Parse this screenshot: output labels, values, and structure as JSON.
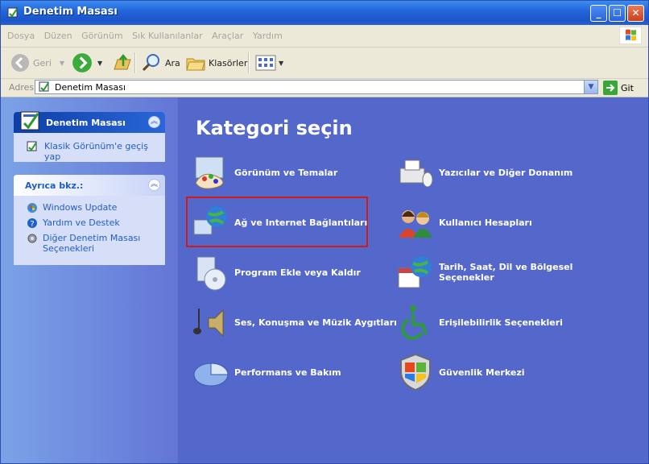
{
  "window": {
    "title": "Denetim Masası"
  },
  "menu": [
    "Dosya",
    "Düzen",
    "Görünüm",
    "Sık Kullanılanlar",
    "Araçlar",
    "Yardım"
  ],
  "toolbar": {
    "back": "Geri",
    "search": "Ara",
    "folders": "Klasörler"
  },
  "address": {
    "label": "Adres",
    "value": "Denetim Masası",
    "go": "Git"
  },
  "sidebar": {
    "panel1": {
      "title": "Denetim Masası",
      "links": [
        "Klasik Görünüm'e geçiş yap"
      ]
    },
    "panel2": {
      "title": "Ayrıca bkz.:",
      "links": [
        "Windows Update",
        "Yardım ve Destek",
        "Diğer Denetim Masası Seçenekleri"
      ]
    }
  },
  "main": {
    "heading": "Kategori seçin",
    "categories": [
      {
        "label": "Görünüm ve Temalar",
        "icon": "appearance-icon"
      },
      {
        "label": "Yazıcılar ve Diğer Donanım",
        "icon": "printer-icon"
      },
      {
        "label": "Ağ ve Internet Bağlantıları",
        "icon": "network-icon"
      },
      {
        "label": "Kullanıcı Hesapları",
        "icon": "users-icon"
      },
      {
        "label": "Program Ekle veya Kaldır",
        "icon": "add-remove-icon"
      },
      {
        "label": "Tarih, Saat, Dil ve Bölgesel Seçenekler",
        "icon": "calendar-globe-icon"
      },
      {
        "label": "Ses, Konuşma ve Müzik Aygıtları",
        "icon": "sound-icon"
      },
      {
        "label": "Erişilebilirlik Seçenekleri",
        "icon": "accessibility-icon"
      },
      {
        "label": "Performans ve Bakım",
        "icon": "performance-icon"
      },
      {
        "label": "Güvenlik Merkezi",
        "icon": "security-shield-icon"
      }
    ]
  },
  "colors": {
    "highlight": "#d11a1a",
    "pane": "#5468cc",
    "link": "#215dc6"
  }
}
